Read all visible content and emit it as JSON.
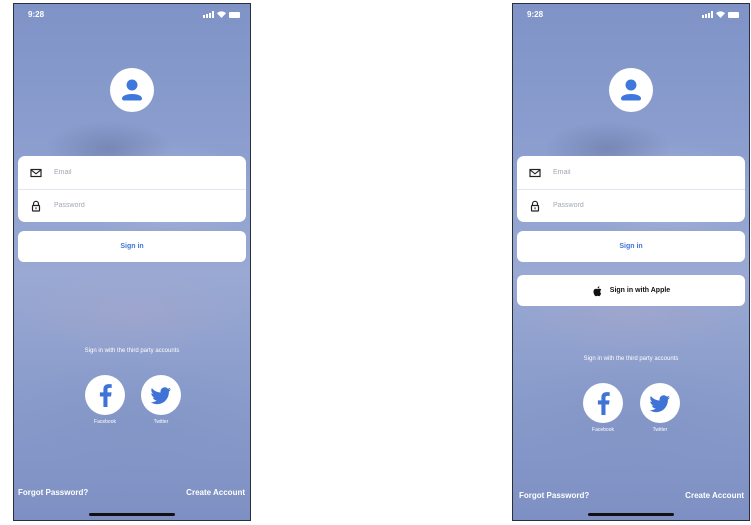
{
  "screens": [
    {
      "status_time": "9:28",
      "email_placeholder": "Email",
      "password_placeholder": "Password",
      "sign_in_label": "Sign in",
      "third_party_text": "Sign in with the third party accounts",
      "facebook_label": "Facebook",
      "twitter_label": "Twitter",
      "forgot_password_label": "Forgot Password?",
      "create_account_label": "Create Account"
    },
    {
      "status_time": "9:28",
      "email_placeholder": "Email",
      "password_placeholder": "Password",
      "sign_in_label": "Sign in",
      "apple_sign_in_label": "Sign in with Apple",
      "third_party_text": "Sign in with the third party accounts",
      "facebook_label": "Facebook",
      "twitter_label": "Twitter",
      "forgot_password_label": "Forgot Password?",
      "create_account_label": "Create Account"
    }
  ],
  "icons": {
    "avatar": "user-avatar-icon",
    "email": "envelope-icon",
    "password": "lock-icon",
    "apple": "apple-logo-icon",
    "facebook": "facebook-icon",
    "twitter": "twitter-icon"
  },
  "colors": {
    "background": "#8d9fcf",
    "card": "#ffffff",
    "accent": "#3d74d8",
    "avatar_glyph": "#3f78dd"
  }
}
